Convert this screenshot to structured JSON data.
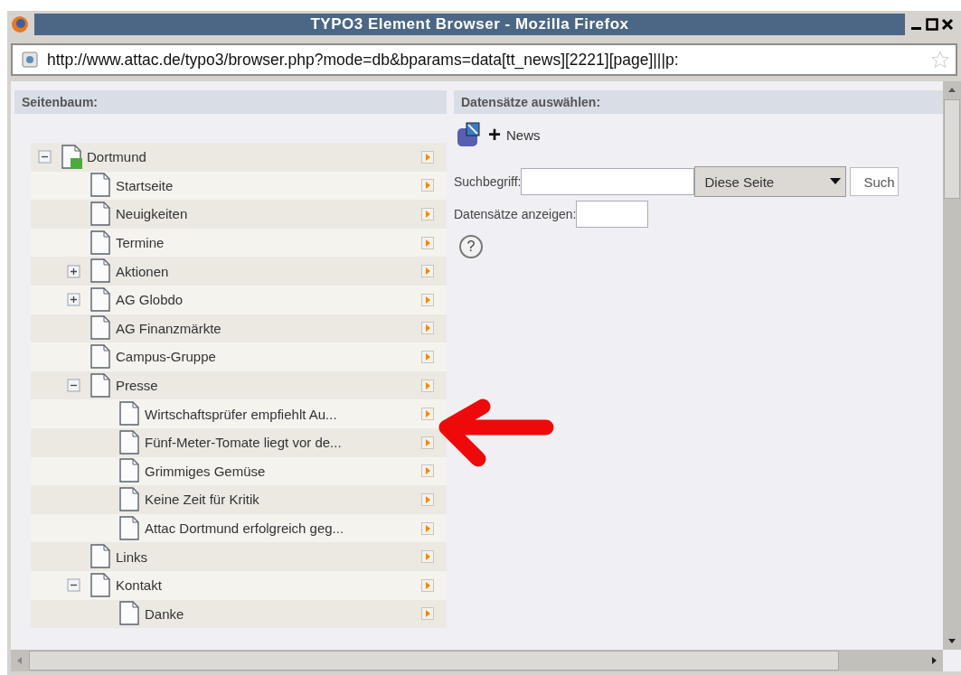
{
  "window": {
    "title": "TYPO3 Element Browser - Mozilla Firefox"
  },
  "address_bar": {
    "url": "http://www.attac.de/typo3/browser.php?mode=db&bparams=data[tt_news][2221][page]|||p:"
  },
  "page_tree": {
    "heading": "Seitenbaum:",
    "items": [
      {
        "label": "Dortmund",
        "expanded": true,
        "children": [
          {
            "label": "Startseite"
          },
          {
            "label": "Neuigkeiten"
          },
          {
            "label": "Termine"
          },
          {
            "label": "Aktionen",
            "expanded": false
          },
          {
            "label": "AG Globdo",
            "expanded": false
          },
          {
            "label": "AG Finanzmärkte"
          },
          {
            "label": "Campus-Gruppe"
          },
          {
            "label": "Presse",
            "expanded": true,
            "children": [
              {
                "label": "Wirtschaftsprüfer empfiehlt Au..."
              },
              {
                "label": "Fünf-Meter-Tomate liegt vor de..."
              },
              {
                "label": "Grimmiges Gemüse"
              },
              {
                "label": "Keine Zeit für Kritik"
              },
              {
                "label": "Attac Dortmund erfolgreich geg..."
              }
            ]
          },
          {
            "label": "Links"
          },
          {
            "label": "Kontakt",
            "expanded": true,
            "children": [
              {
                "label": "Danke"
              }
            ]
          }
        ]
      }
    ]
  },
  "records": {
    "heading": "Datensätze auswählen:",
    "new_plus": "+",
    "table": "News",
    "search_label": "Suchbegriff:",
    "scope": "Diese Seite",
    "search_button": "Such",
    "show_label": "Datensätze anzeigen:",
    "help": "?"
  }
}
